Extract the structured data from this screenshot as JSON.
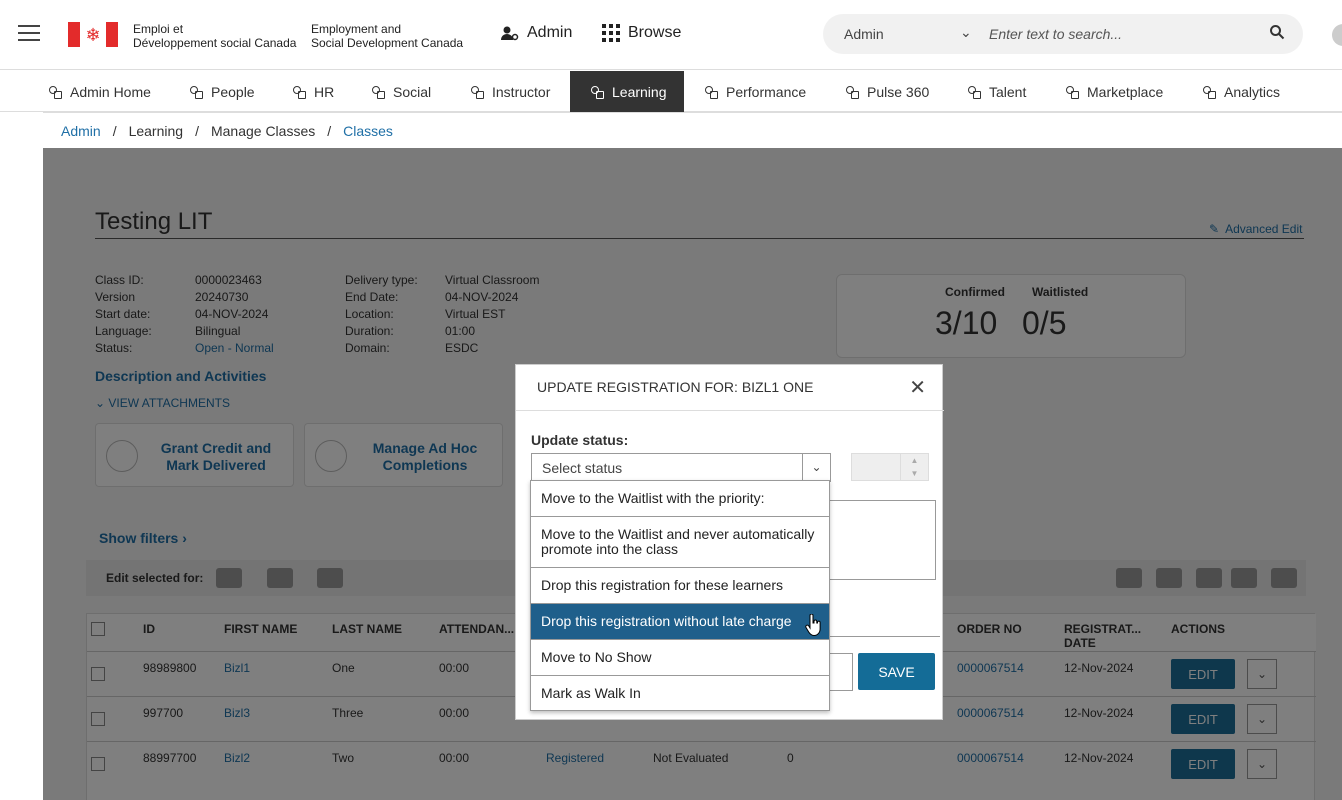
{
  "header": {
    "sig_fr_line1": "Emploi et",
    "sig_fr_line2": "Développement social Canada",
    "sig_en_line1": "Employment and",
    "sig_en_line2": "Social Development Canada",
    "admin_label": "Admin",
    "browse_label": "Browse",
    "search_scope": "Admin",
    "search_placeholder": "Enter text to search..."
  },
  "nav": {
    "items": [
      {
        "label": "Admin Home"
      },
      {
        "label": "People"
      },
      {
        "label": "HR"
      },
      {
        "label": "Social"
      },
      {
        "label": "Instructor"
      },
      {
        "label": "Learning"
      },
      {
        "label": "Performance"
      },
      {
        "label": "Pulse 360"
      },
      {
        "label": "Talent"
      },
      {
        "label": "Marketplace"
      },
      {
        "label": "Analytics"
      }
    ],
    "active": "Learning"
  },
  "breadcrumb": {
    "items": [
      "Admin",
      "Learning",
      "Manage Classes",
      "Classes"
    ],
    "separator": "/"
  },
  "class": {
    "title": "Testing LIT",
    "advanced_edit": "Advanced Edit",
    "meta_left": [
      {
        "label": "Class ID:",
        "value": "0000023463"
      },
      {
        "label": "Version",
        "value": "20240730"
      },
      {
        "label": "Start date:",
        "value": "04-NOV-2024"
      },
      {
        "label": "Language:",
        "value": "Bilingual"
      },
      {
        "label": "Status:",
        "value": "Open - Normal"
      }
    ],
    "meta_right": [
      {
        "label": "Delivery type:",
        "value": "Virtual Classroom"
      },
      {
        "label": "End Date:",
        "value": "04-NOV-2024"
      },
      {
        "label": "Location:",
        "value": "Virtual EST"
      },
      {
        "label": "Duration:",
        "value": "01:00"
      },
      {
        "label": "Domain:",
        "value": "ESDC"
      }
    ],
    "confirmed_label": "Confirmed",
    "confirmed_value": "3/10",
    "waitlisted_label": "Waitlisted",
    "waitlisted_value": "0/5",
    "desc_title": "Description and Activities",
    "view_attachments": "VIEW ATTACHMENTS",
    "card1_line1": "Grant Credit and",
    "card1_line2": "Mark Delivered",
    "card2_line1": "Manage Ad Hoc",
    "card2_line2": "Completions",
    "show_filters": "Show filters",
    "edit_selected": "Edit selected for:"
  },
  "table": {
    "headers": {
      "id": "ID",
      "first": "FIRST NAME",
      "last": "LAST NAME",
      "attend": "ATTENDAN...",
      "order": "ORDER NO",
      "regdate_1": "REGISTRAT...",
      "regdate_2": "DATE",
      "actions": "ACTIONS"
    },
    "rows": [
      {
        "id": "98989800",
        "first": "Bizl1",
        "last": "One",
        "attend": "00:00",
        "status": "",
        "eval": "",
        "num": "",
        "order": "0000067514",
        "date": "12-Nov-2024",
        "edit": "EDIT"
      },
      {
        "id": "997700",
        "first": "Bizl3",
        "last": "Three",
        "attend": "00:00",
        "status": "",
        "eval": "",
        "num": "",
        "order": "0000067514",
        "date": "12-Nov-2024",
        "edit": "EDIT"
      },
      {
        "id": "88997700",
        "first": "Bizl2",
        "last": "Two",
        "attend": "00:00",
        "status": "Registered",
        "eval": "Not Evaluated",
        "num": "0",
        "order": "0000067514",
        "date": "12-Nov-2024",
        "edit": "EDIT"
      }
    ]
  },
  "modal": {
    "title": "UPDATE REGISTRATION FOR: BIZL1 ONE",
    "update_status_label": "Update status:",
    "select_placeholder": "Select status",
    "save_label": "SAVE",
    "options": [
      "Move to the Waitlist with the priority:",
      "Move to the Waitlist and never automatically promote into the class",
      "Drop this registration for these learners",
      "Drop this registration without late charge",
      "Move to No Show",
      "Mark as Walk In"
    ],
    "highlighted_option_index": 3
  },
  "colors": {
    "link": "#1f6fa6",
    "nav_active_bg": "#333333",
    "primary_button": "#146c97",
    "highlight": "#1f5f8b",
    "flag_red": "#e32b2b"
  }
}
